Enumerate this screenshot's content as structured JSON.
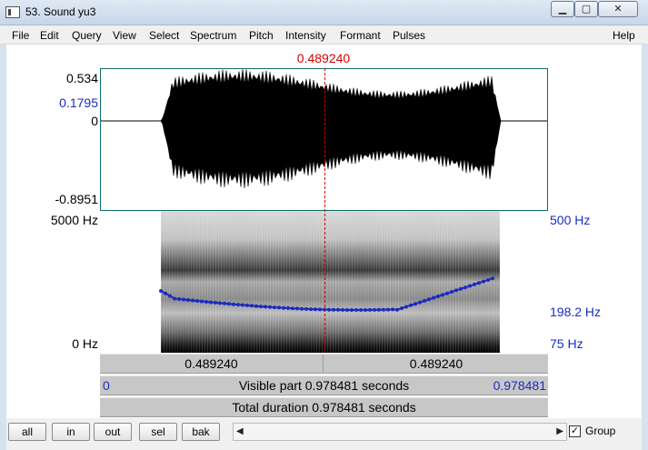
{
  "window": {
    "title": "53. Sound yu3",
    "minimize_glyph": "▁",
    "maximize_glyph": "▢",
    "close_glyph": "✕"
  },
  "menu": {
    "items": [
      "File",
      "Edit",
      "Query",
      "View",
      "Select",
      "Spectrum",
      "Pitch",
      "Intensity",
      "Formant",
      "Pulses"
    ],
    "help": "Help"
  },
  "cursor": {
    "time_label": "0.489240"
  },
  "waveform": {
    "max_label": "0.534",
    "cursor_value": "0.1795",
    "zero_label": "0",
    "min_label": "-0.8951"
  },
  "spectrogram": {
    "freq_top": "5000 Hz",
    "freq_bottom": "0 Hz",
    "pitch_top": "500 Hz",
    "pitch_cursor": "198.2 Hz",
    "pitch_bottom": "75 Hz"
  },
  "time_bars": {
    "left_time": "0.489240",
    "right_time": "0.489240",
    "visible_start": "0",
    "visible_label": "Visible part 0.978481 seconds",
    "visible_end": "0.978481",
    "total_label": "Total duration 0.978481 seconds"
  },
  "buttons": {
    "all": "all",
    "in": "in",
    "out": "out",
    "sel": "sel",
    "bak": "bak"
  },
  "scroll": {
    "left": "◀",
    "right": "▶"
  },
  "group": {
    "label": "Group",
    "checked": true,
    "check_glyph": "✓"
  },
  "colors": {
    "cursor": "#d40000",
    "pitch": "#1a2bc0",
    "waveform": "#000000",
    "box_border": "#0d6b6b"
  }
}
